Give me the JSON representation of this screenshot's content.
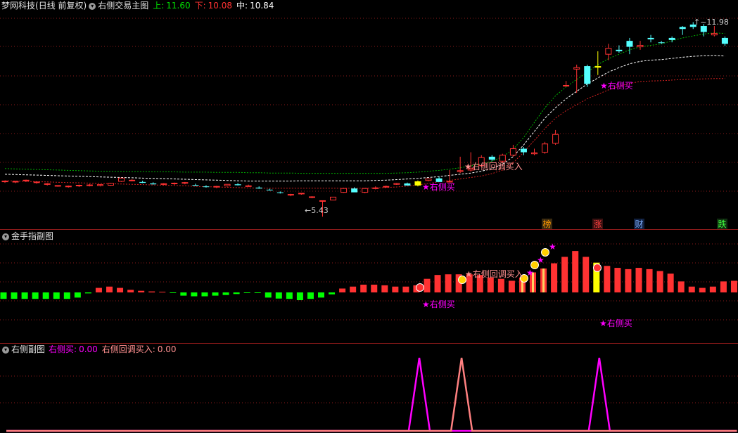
{
  "main_panel": {
    "stock_name": "梦网科技",
    "period": "(日线 前复权)",
    "indicator_name": "右侧交易主图",
    "upper_label": "上:",
    "upper_value": "11.60",
    "lower_label": "下:",
    "lower_value": "10.08",
    "mid_label": "中:",
    "mid_value": "10.84",
    "high_annotation": "11.98",
    "low_annotation": "5.43",
    "signal_buy": "★右侧买",
    "signal_pullback": "★右侧回调买入",
    "badges": [
      "榜",
      "涨",
      "财",
      "跌"
    ]
  },
  "sub_panel1": {
    "title": "金手指副图",
    "signal_buy": "★右侧买",
    "signal_pullback": "★右侧回调买入"
  },
  "sub_panel2": {
    "title": "右侧副图",
    "buy_label": "右侧买:",
    "buy_value": "0.00",
    "pullback_label": "右侧回调买入:",
    "pullback_value": "0.00"
  },
  "colors": {
    "up": "#ff3232",
    "down": "#54ffff",
    "yellow": "#ffff00",
    "magenta": "#ff00ff",
    "green_bar": "#00ff00",
    "pink": "#ff8080",
    "grid": "#8b1a1a"
  },
  "chart_data": [
    {
      "type": "candlestick",
      "title": "右侧交易主图",
      "series": [
        {
          "name": "上",
          "values": [
            7.05,
            7.04,
            7.03,
            7.02,
            7.01,
            7.0,
            6.99,
            6.98,
            6.97,
            6.96,
            6.96,
            6.95,
            6.95,
            6.95,
            6.94,
            6.94,
            6.94,
            6.93,
            6.93,
            6.93,
            6.92,
            6.92,
            6.92,
            6.91,
            6.91,
            6.9,
            6.9,
            6.9,
            6.89,
            6.89,
            6.89,
            6.89,
            6.89,
            6.89,
            6.89,
            6.89,
            6.89,
            6.9,
            6.91,
            6.93,
            6.96,
            6.99,
            7.03,
            7.08,
            7.14,
            7.2,
            7.3,
            7.45,
            7.7,
            8.1,
            8.6,
            9.1,
            9.5,
            9.8,
            10.05,
            10.3,
            10.55,
            10.75,
            10.9,
            11.05,
            11.15,
            11.2,
            11.25,
            11.35,
            11.45,
            11.52,
            11.58,
            11.62,
            11.6
          ]
        },
        {
          "name": "中",
          "values": [
            6.86,
            6.85,
            6.84,
            6.83,
            6.82,
            6.81,
            6.8,
            6.79,
            6.78,
            6.77,
            6.76,
            6.75,
            6.74,
            6.73,
            6.72,
            6.71,
            6.7,
            6.69,
            6.68,
            6.67,
            6.66,
            6.65,
            6.64,
            6.63,
            6.63,
            6.63,
            6.63,
            6.63,
            6.64,
            6.64,
            6.64,
            6.64,
            6.64,
            6.64,
            6.64,
            6.65,
            6.66,
            6.68,
            6.7,
            6.72,
            6.75,
            6.78,
            6.82,
            6.86,
            6.9,
            6.96,
            7.05,
            7.2,
            7.45,
            7.85,
            8.3,
            8.75,
            9.1,
            9.4,
            9.65,
            9.9,
            10.1,
            10.3,
            10.45,
            10.58,
            10.66,
            10.7,
            10.72,
            10.76,
            10.8,
            10.83,
            10.85,
            10.86,
            10.84
          ]
        },
        {
          "name": "下",
          "values": [
            6.64,
            6.63,
            6.62,
            6.61,
            6.6,
            6.59,
            6.58,
            6.57,
            6.56,
            6.55,
            6.54,
            6.53,
            6.52,
            6.51,
            6.5,
            6.49,
            6.48,
            6.47,
            6.45,
            6.44,
            6.43,
            6.42,
            6.41,
            6.4,
            6.39,
            6.39,
            6.39,
            6.39,
            6.39,
            6.39,
            6.39,
            6.39,
            6.39,
            6.39,
            6.39,
            6.4,
            6.41,
            6.43,
            6.46,
            6.5,
            6.55,
            6.6,
            6.65,
            6.7,
            6.75,
            6.8,
            6.88,
            7.0,
            7.25,
            7.6,
            8.0,
            8.4,
            8.75,
            9.0,
            9.2,
            9.4,
            9.55,
            9.7,
            9.82,
            9.92,
            9.98,
            10.0,
            10.01,
            10.03,
            10.05,
            10.06,
            10.07,
            10.08,
            10.08
          ]
        },
        {
          "name": "K",
          "ohlc": [
            [
              6.61,
              6.65,
              6.57,
              6.63
            ],
            [
              6.6,
              6.64,
              6.56,
              6.62
            ],
            [
              6.64,
              6.68,
              6.6,
              6.66
            ],
            [
              6.58,
              6.62,
              6.54,
              6.6
            ],
            [
              6.52,
              6.56,
              6.48,
              6.54
            ],
            [
              6.47,
              6.49,
              6.44,
              6.48
            ],
            [
              6.44,
              6.48,
              6.41,
              6.46
            ],
            [
              6.47,
              6.51,
              6.43,
              6.49
            ],
            [
              6.48,
              6.53,
              6.45,
              6.5
            ],
            [
              6.48,
              6.52,
              6.45,
              6.51
            ],
            [
              6.49,
              6.57,
              6.47,
              6.55
            ],
            [
              6.62,
              6.75,
              6.6,
              6.73
            ],
            [
              6.65,
              6.69,
              6.62,
              6.66
            ],
            [
              6.6,
              6.64,
              6.56,
              6.57
            ],
            [
              6.55,
              6.59,
              6.51,
              6.52
            ],
            [
              6.52,
              6.56,
              6.49,
              6.54
            ],
            [
              6.54,
              6.58,
              6.5,
              6.56
            ],
            [
              6.56,
              6.6,
              6.52,
              6.58
            ],
            [
              6.5,
              6.54,
              6.46,
              6.48
            ],
            [
              6.45,
              6.49,
              6.41,
              6.44
            ],
            [
              6.43,
              6.47,
              6.39,
              6.45
            ],
            [
              6.47,
              6.51,
              6.44,
              6.52
            ],
            [
              6.52,
              6.56,
              6.48,
              6.49
            ],
            [
              6.47,
              6.51,
              6.44,
              6.47
            ],
            [
              6.41,
              6.45,
              6.37,
              6.38
            ],
            [
              6.34,
              6.37,
              6.31,
              6.33
            ],
            [
              6.25,
              6.28,
              6.21,
              6.23
            ],
            [
              6.16,
              6.2,
              6.12,
              6.18
            ],
            [
              6.2,
              6.23,
              6.17,
              6.22
            ],
            [
              6.08,
              6.12,
              6.05,
              6.1
            ],
            [
              5.96,
              5.98,
              5.43,
              5.97
            ],
            [
              5.99,
              6.1,
              5.98,
              6.09
            ],
            [
              6.25,
              6.4,
              6.23,
              6.38
            ],
            [
              6.38,
              6.42,
              6.35,
              6.25
            ],
            [
              6.25,
              6.4,
              6.22,
              6.38
            ],
            [
              6.38,
              6.45,
              6.35,
              6.4
            ],
            [
              6.43,
              6.48,
              6.41,
              6.45
            ],
            [
              6.52,
              6.57,
              6.5,
              6.55
            ],
            [
              6.55,
              6.58,
              6.52,
              6.48
            ],
            [
              6.48,
              6.65,
              6.45,
              6.62
            ],
            [
              6.65,
              6.72,
              6.62,
              6.7
            ],
            [
              6.72,
              6.78,
              6.68,
              6.6
            ],
            [
              6.6,
              7.0,
              6.58,
              6.62
            ],
            [
              6.95,
              7.45,
              6.9,
              6.98
            ],
            [
              7.0,
              7.6,
              6.95,
              7.05
            ],
            [
              7.15,
              7.5,
              7.1,
              7.42
            ],
            [
              7.45,
              7.5,
              7.3,
              7.35
            ],
            [
              7.3,
              7.55,
              7.25,
              7.5
            ],
            [
              7.5,
              7.85,
              7.45,
              7.72
            ],
            [
              7.72,
              7.78,
              7.5,
              7.6
            ],
            [
              7.55,
              7.72,
              7.5,
              7.58
            ],
            [
              7.6,
              7.95,
              7.55,
              7.88
            ],
            [
              7.9,
              8.35,
              7.85,
              8.2
            ],
            [
              9.85,
              10.0,
              9.84,
              9.85
            ],
            [
              10.4,
              10.55,
              9.6,
              10.45
            ],
            [
              10.5,
              10.55,
              9.8,
              9.9
            ],
            [
              10.5,
              11.0,
              10.2,
              10.45
            ],
            [
              10.9,
              11.25,
              10.7,
              11.1
            ],
            [
              11.05,
              11.2,
              10.95,
              11.0
            ],
            [
              11.35,
              11.45,
              10.9,
              11.15
            ],
            [
              11.15,
              11.35,
              11.05,
              11.2
            ],
            [
              11.45,
              11.55,
              11.3,
              11.4
            ],
            [
              11.3,
              11.35,
              11.25,
              11.28
            ],
            [
              11.45,
              11.5,
              11.3,
              11.38
            ],
            [
              11.82,
              11.85,
              11.55,
              11.75
            ],
            [
              11.9,
              11.98,
              11.75,
              11.82
            ],
            [
              11.85,
              11.92,
              11.5,
              11.65
            ],
            [
              11.55,
              11.85,
              11.5,
              11.6
            ],
            [
              11.45,
              11.5,
              11.18,
              11.25
            ]
          ]
        }
      ],
      "ylim": [
        5.2,
        12.3
      ]
    },
    {
      "type": "bar",
      "title": "金手指副图",
      "series": [
        {
          "values": [
            -2,
            -2,
            -2,
            -2,
            -2,
            -2,
            -2,
            -1.6,
            -0.3,
            1.4,
            1.8,
            1.4,
            0.8,
            0.5,
            0.3,
            0.2,
            -0.2,
            -1,
            -1.2,
            -1.2,
            -1,
            -0.8,
            -0.5,
            -0.2,
            -0.2,
            -1.6,
            -1.9,
            -2,
            -2.4,
            -2,
            -1.6,
            -0.6,
            1.2,
            1.8,
            2.4,
            2.4,
            2.2,
            1.8,
            1.8,
            2.2,
            4.2,
            5.4,
            5.6,
            5.6,
            5.6,
            5.4,
            4.6,
            4.2,
            3.6,
            4.6,
            6.2,
            7.4,
            9.0,
            11.0,
            12.8,
            11.0,
            9.2,
            8.2,
            7.6,
            7.2,
            7.6,
            7.2,
            6.6,
            5.8,
            3.4,
            1.8,
            1.4,
            1.8,
            3.4,
            3.6,
            2.8,
            1.6
          ]
        }
      ],
      "ylim": [
        -5,
        14
      ]
    },
    {
      "type": "line",
      "title": "右侧副图",
      "series": [
        {
          "name": "右侧买",
          "values": [
            0,
            0,
            0,
            0,
            0,
            0,
            0,
            0,
            0,
            0,
            0,
            0,
            0,
            0,
            0,
            0,
            0,
            0,
            0,
            0,
            0,
            0,
            0,
            0,
            0,
            0,
            0,
            0,
            0,
            0,
            0,
            0,
            0,
            0,
            0,
            0,
            0,
            0,
            0,
            1,
            0,
            0,
            0,
            0,
            0,
            0,
            0,
            0,
            0,
            0,
            0,
            0,
            0,
            0,
            0,
            0,
            1,
            0,
            0,
            0,
            0,
            0,
            0,
            0,
            0,
            0,
            0,
            0,
            0,
            0
          ]
        },
        {
          "name": "右侧回调买入",
          "values": [
            0,
            0,
            0,
            0,
            0,
            0,
            0,
            0,
            0,
            0,
            0,
            0,
            0,
            0,
            0,
            0,
            0,
            0,
            0,
            0,
            0,
            0,
            0,
            0,
            0,
            0,
            0,
            0,
            0,
            0,
            0,
            0,
            0,
            0,
            0,
            0,
            0,
            0,
            0,
            0,
            0,
            0,
            0,
            1,
            0,
            0,
            0,
            0,
            0,
            0,
            0,
            0,
            0,
            0,
            0,
            0,
            0,
            0,
            0,
            0,
            0,
            0,
            0,
            0,
            0,
            0,
            0,
            0,
            0,
            0
          ]
        }
      ],
      "ylim": [
        0,
        1
      ]
    }
  ]
}
